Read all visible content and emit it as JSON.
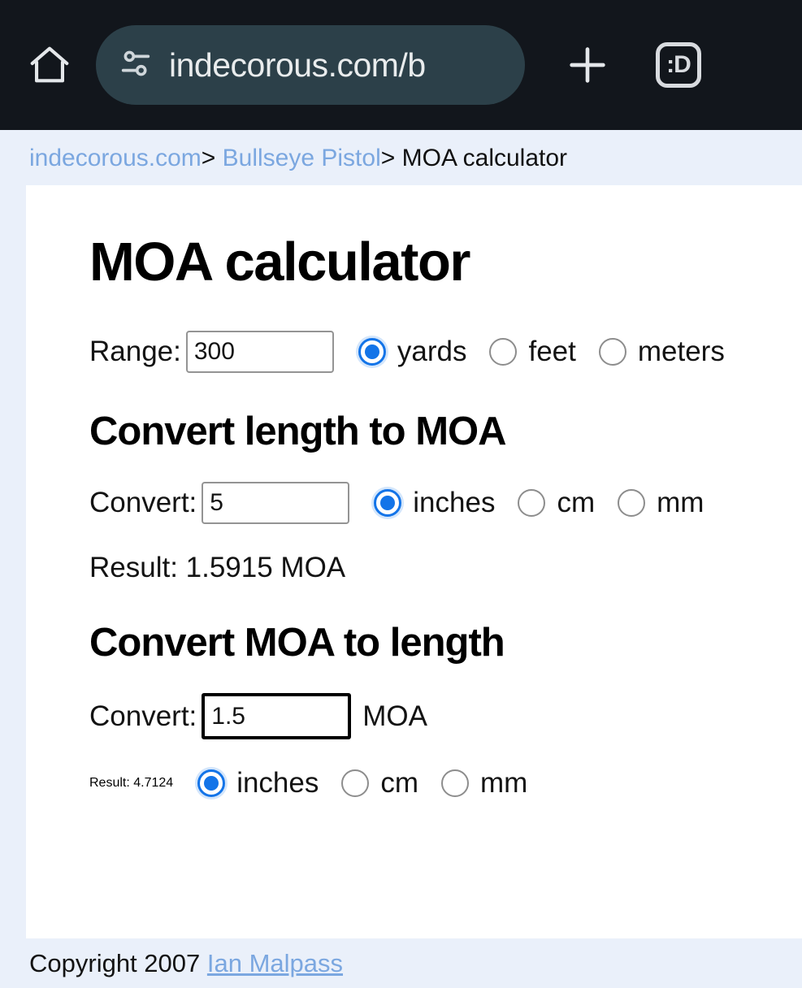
{
  "browser": {
    "home_icon": "home-icon",
    "site_settings_icon": "tune-sliders-icon",
    "url": "indecorous.com/b",
    "new_tab_icon": "plus-icon",
    "tab_count_label": ":D"
  },
  "breadcrumb": {
    "site": "indecorous.com",
    "separator": ">",
    "section": "Bullseye Pistol",
    "current": "MOA calculator"
  },
  "page": {
    "title": "MOA calculator",
    "range": {
      "label": "Range:",
      "value": "300",
      "units": [
        {
          "label": "yards",
          "checked": true
        },
        {
          "label": "feet",
          "checked": false
        },
        {
          "label": "meters",
          "checked": false
        }
      ]
    },
    "length_to_moa": {
      "heading": "Convert length to MOA",
      "convert_label": "Convert:",
      "value": "5",
      "units": [
        {
          "label": "inches",
          "checked": true
        },
        {
          "label": "cm",
          "checked": false
        },
        {
          "label": "mm",
          "checked": false
        }
      ],
      "result": "Result: 1.5915 MOA"
    },
    "moa_to_length": {
      "heading": "Convert MOA to length",
      "convert_label": "Convert:",
      "value": "1.5",
      "suffix": "MOA",
      "result_label": "Result: 4.7124",
      "units": [
        {
          "label": "inches",
          "checked": true
        },
        {
          "label": "cm",
          "checked": false
        },
        {
          "label": "mm",
          "checked": false
        }
      ]
    }
  },
  "footer": {
    "text": "Copyright 2007",
    "link": "Ian Malpass"
  },
  "colors": {
    "chrome_bg": "#12161c",
    "urlbar_bg": "#2c4049",
    "page_bg": "#eaf0fa",
    "card_bg": "#ffffff",
    "link": "#7ba7e0",
    "accent": "#1374e8"
  }
}
